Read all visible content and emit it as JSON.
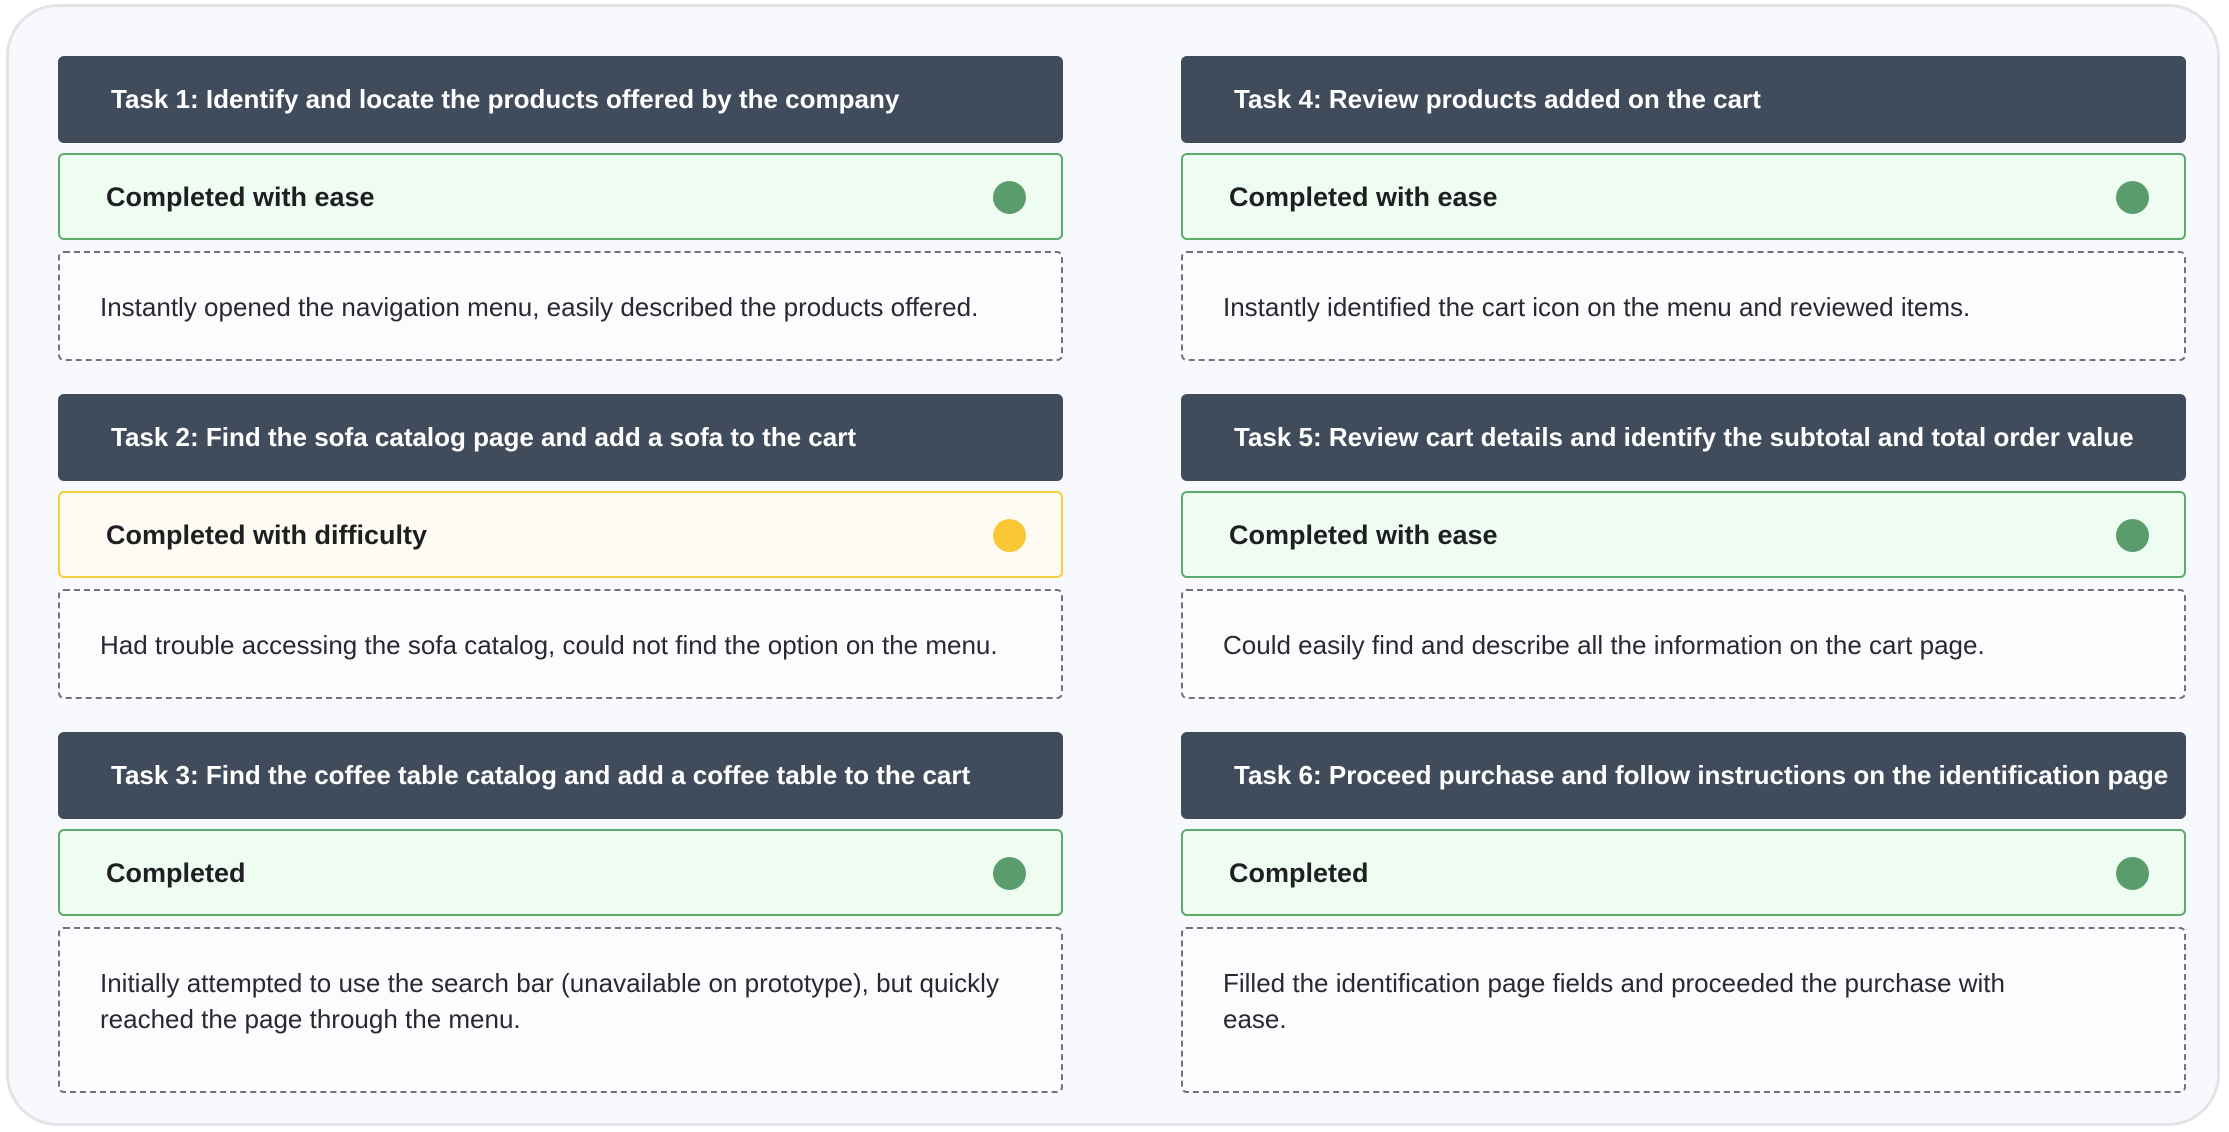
{
  "tasks": [
    {
      "title": "Task 1: Identify and locate the products offered by the company",
      "status": "Completed with ease",
      "status_color": "#5b9c6c",
      "note": "Instantly opened the navigation menu, easily described the products offered."
    },
    {
      "title": "Task 2: Find the sofa catalog page and add a sofa to the cart",
      "status": "Completed with difficulty",
      "status_color": "#f8c733",
      "note": "Had trouble accessing the sofa catalog, could not find the option on the menu."
    },
    {
      "title": "Task 3: Find the coffee table catalog and add a coffee table to the cart",
      "status": "Completed",
      "status_color": "#5b9c6c",
      "note": "Initially attempted to use the search bar (unavailable on prototype), but quickly reached the page through the menu."
    },
    {
      "title": "Task 4: Review products added on the cart",
      "status": "Completed with ease",
      "status_color": "#5b9c6c",
      "note": "Instantly identified the cart icon on the menu and reviewed items."
    },
    {
      "title": "Task 5: Review cart details and identify the subtotal and total order value",
      "status": "Completed with ease",
      "status_color": "#5b9c6c",
      "note": "Could easily find and describe all the information on the cart page."
    },
    {
      "title": "Task 6: Proceed purchase and follow instructions on the identification page",
      "status": "Completed",
      "status_color": "#5b9c6c",
      "note": "Filled the identification page fields and proceeded the purchase with ease."
    }
  ]
}
